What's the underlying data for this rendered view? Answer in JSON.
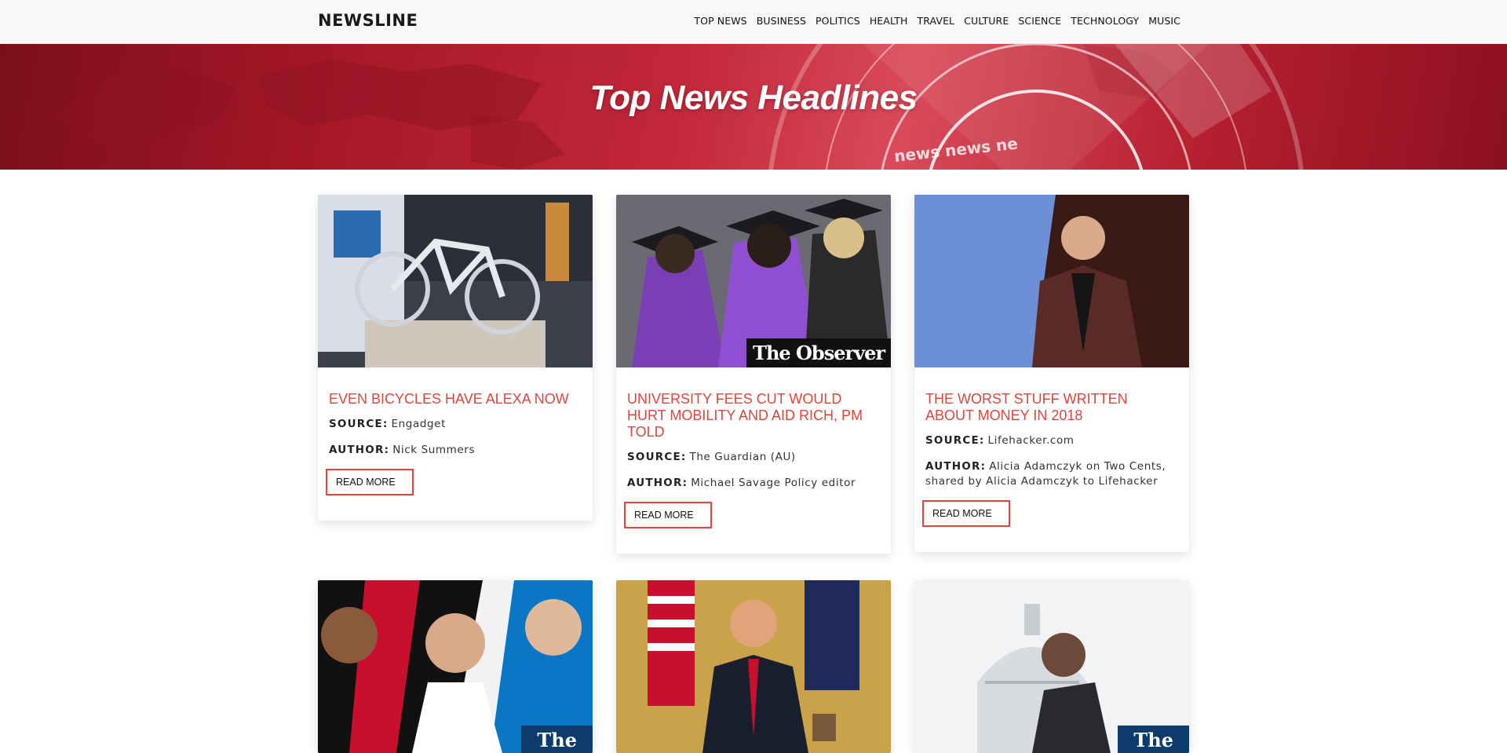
{
  "brand": "NEWSLINE",
  "nav": [
    "TOP NEWS",
    "BUSINESS",
    "POLITICS",
    "HEALTH",
    "TRAVEL",
    "CULTURE",
    "SCIENCE",
    "TECHNOLOGY",
    "MUSIC"
  ],
  "hero": {
    "title": "Top News Headlines",
    "overlay_text": "news news ne"
  },
  "colors": {
    "accent": "#e0453a",
    "hero_red": "#b51f30",
    "nav_bg": "#f7f8fa"
  },
  "labels": {
    "source": "SOURCE:",
    "author": "AUTHOR:",
    "read_more": "READ MORE"
  },
  "cards": [
    {
      "title": "EVEN BICYCLES HAVE ALEXA NOW",
      "source": "Engadget",
      "author": "Nick Summers",
      "image": "bicycle-photo"
    },
    {
      "title": "UNIVERSITY FEES CUT WOULD HURT MOBILITY AND AID RICH, PM TOLD",
      "source": "The Guardian (AU)",
      "author": "Michael Savage Policy editor",
      "image": "graduates-photo",
      "image_badge": "The Observer"
    },
    {
      "title": "THE WORST STUFF WRITTEN ABOUT MONEY IN 2018",
      "source": "Lifehacker.com",
      "author": "Alicia Adamczyk on Two Cents, shared by Alicia Adamczyk to Lifehacker",
      "image": "speaker-photo"
    },
    {
      "image": "footballers-photo",
      "image_badge": "The"
    },
    {
      "image": "oval-office-photo"
    },
    {
      "image": "capitol-photo",
      "image_badge": "The"
    }
  ]
}
